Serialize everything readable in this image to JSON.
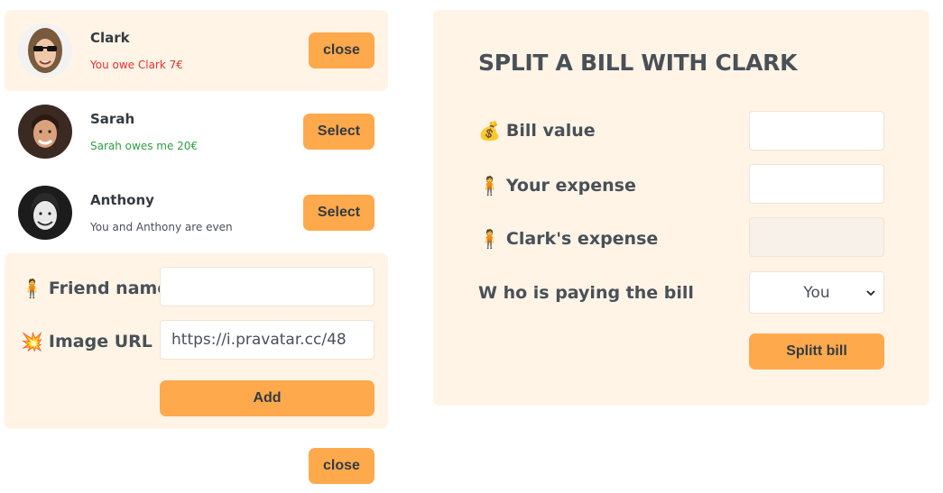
{
  "friends": [
    {
      "name": "Clark",
      "status": "You owe Clark 7€",
      "status_type": "owe",
      "button": "close",
      "selected": true
    },
    {
      "name": "Sarah",
      "status": "Sarah owes me 20€",
      "status_type": "owed",
      "button": "Select",
      "selected": false
    },
    {
      "name": "Anthony",
      "status": "You and Anthony are even",
      "status_type": "even",
      "button": "Select",
      "selected": false
    }
  ],
  "add_friend_form": {
    "name_label": "Friend name",
    "name_icon": "person-emoji",
    "name_value": "",
    "image_label": "Image URL",
    "image_icon": "collision-emoji",
    "image_value": "https://i.pravatar.cc/48",
    "add_button": "Add"
  },
  "close_form_button": "close",
  "split_form": {
    "title": "SPLIT A BILL WITH CLARK",
    "bill_label": "Bill value",
    "bill_icon": "money-bag-emoji",
    "bill_value": "",
    "your_expense_label": "Your expense",
    "your_expense_icon": "person-emoji",
    "your_expense_value": "",
    "friend_expense_label": "Clark's expense",
    "friend_expense_icon": "person-emoji",
    "friend_expense_value": "",
    "payer_label": "W ho is paying the bill",
    "payer_selected": "You",
    "submit_button": "Splitt bill"
  },
  "colors": {
    "accent": "#ffa94d",
    "panel": "#fff4e6",
    "owe": "#e03131",
    "owed": "#2f9e44"
  }
}
